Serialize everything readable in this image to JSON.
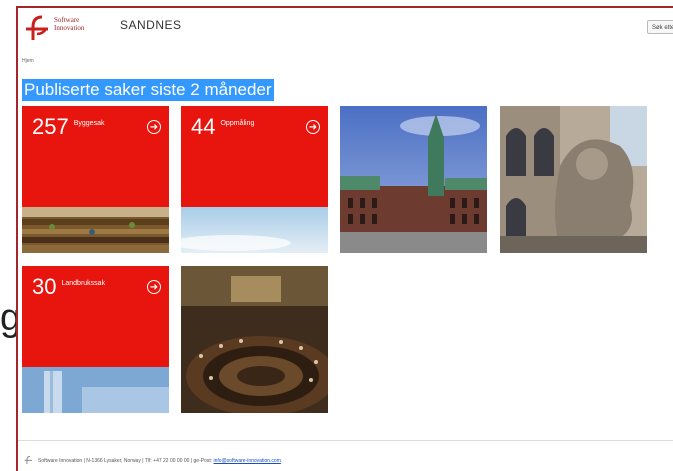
{
  "header": {
    "logo_text_line1": "Software",
    "logo_text_line2": "Innovation",
    "brand": "SANDNES",
    "button_label": "Søk etter"
  },
  "breadcrumb": "Hjem",
  "page_title": "Publiserte saker siste 2 måneder",
  "tiles": [
    {
      "count": "257",
      "label": "Byggesak"
    },
    {
      "count": "44",
      "label": "Oppmåling"
    },
    {
      "count": "30",
      "label": "Landbrukssak"
    }
  ],
  "icons": {
    "arrow": "arrow-right-circle-icon",
    "logo": "software-innovation-logo-icon"
  },
  "stray_glyph": "g",
  "footer": {
    "text": "Software Innovation | N-1366 Lysaker, Norway | Tlf: +47 22 00 00 00 | ge-Post:",
    "link": "info@software-innovation.com"
  },
  "colors": {
    "accent": "#e8140e",
    "frame": "#a2262b",
    "highlight": "#3399ff"
  }
}
